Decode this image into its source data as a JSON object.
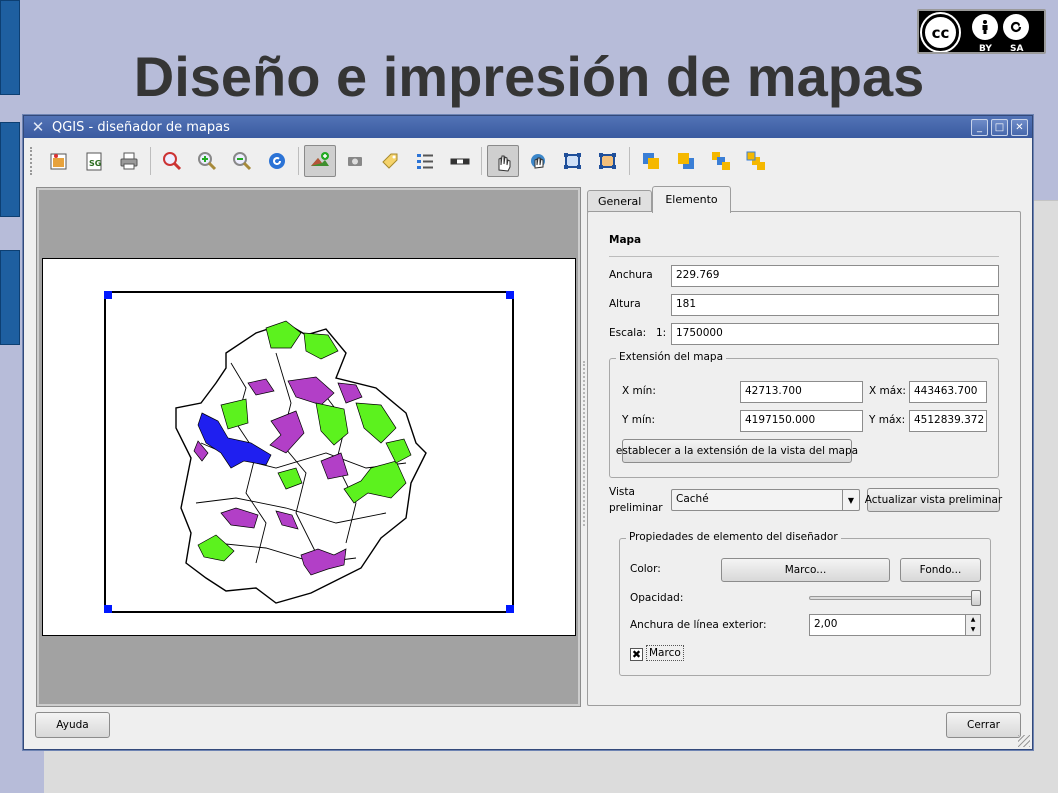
{
  "slide": {
    "title": "Diseño e impresión de mapas"
  },
  "license": {
    "logo_text": "cc",
    "by_label": "BY",
    "sa_label": "SA"
  },
  "window": {
    "title": "QGIS - diseñador de mapas"
  },
  "toolbar": {
    "icons": [
      "add-new-composer-icon",
      "export-image-icon",
      "export-svg-icon",
      "print-icon",
      "zoom-full-icon",
      "zoom-in-icon",
      "zoom-out-icon",
      "refresh-icon",
      "add-map-icon",
      "add-image-icon",
      "add-label-icon",
      "add-legend-icon",
      "add-scalebar-icon",
      "select-move-icon",
      "move-content-icon",
      "group-icon",
      "ungroup-icon",
      "raise-icon",
      "lower-icon",
      "bring-to-front-icon",
      "send-to-back-icon"
    ]
  },
  "tabs": {
    "general": "General",
    "element": "Elemento"
  },
  "panel": {
    "section_title": "Mapa",
    "width_label": "Anchura",
    "width_value": "229.769",
    "height_label": "Altura",
    "height_value": "181",
    "scale_label": "Escala:",
    "scale_prefix": "1:",
    "scale_value": "1750000",
    "extent": {
      "title": "Extensión del mapa",
      "xmin_label": "X mín:",
      "xmin_value": "42713.700",
      "xmax_label": "X máx:",
      "xmax_value": "443463.700",
      "ymin_label": "Y mín:",
      "ymin_value": "4197150.000",
      "ymax_label": "Y máx:",
      "ymax_value": "4512839.372",
      "set_button": "establecer a la extensión de la vista del mapa"
    },
    "preview_label_1": "Vista",
    "preview_label_2": "preliminar",
    "preview_value": "Caché",
    "update_preview_button": "Actualizar vista preliminar",
    "item_props": {
      "title": "Propiedades de elemento del diseñador",
      "color_label": "Color:",
      "frame_button": "Marco...",
      "background_button": "Fondo...",
      "opacity_label": "Opacidad:",
      "opacity_value": 1.0,
      "outline_label": "Anchura de línea exterior:",
      "outline_value": "2,00",
      "frame_check_label": "Marco",
      "frame_checked": true
    }
  },
  "footer": {
    "help_button": "Ayuda",
    "close_button": "Cerrar"
  },
  "colors": {
    "accent": "#3a5aa0",
    "map_green": "#5cf21e",
    "map_magenta": "#b23fc7",
    "map_blue": "#1f1ff0",
    "handle": "#0018ff"
  }
}
